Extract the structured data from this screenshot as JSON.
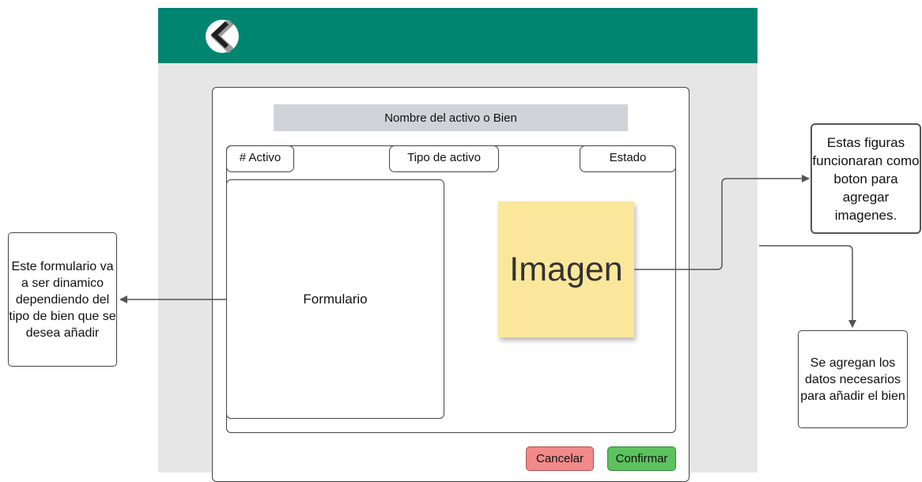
{
  "modal": {
    "title": "Nombre del activo o Bien",
    "fields": {
      "activo": "# Activo",
      "tipo": "Tipo de activo",
      "estado": "Estado"
    },
    "form_label": "Formulario",
    "image_label": "Imagen",
    "cancel_label": "Cancelar",
    "confirm_label": "Confirmar"
  },
  "annotations": {
    "form_note": "Este formulario va a ser dinamico dependiendo del tipo de bien que se desea añadir",
    "image_note": "Estas figuras funcionaran como boton para agregar imagenes.",
    "data_note": "Se agregan los datos necesarios para añadir el bien"
  },
  "colors": {
    "header": "#008571",
    "sticky_note": "#fbe79c",
    "cancel": "#f28a8a",
    "confirm": "#5cc25e"
  },
  "icons": {
    "back": "back-chevron-icon"
  }
}
